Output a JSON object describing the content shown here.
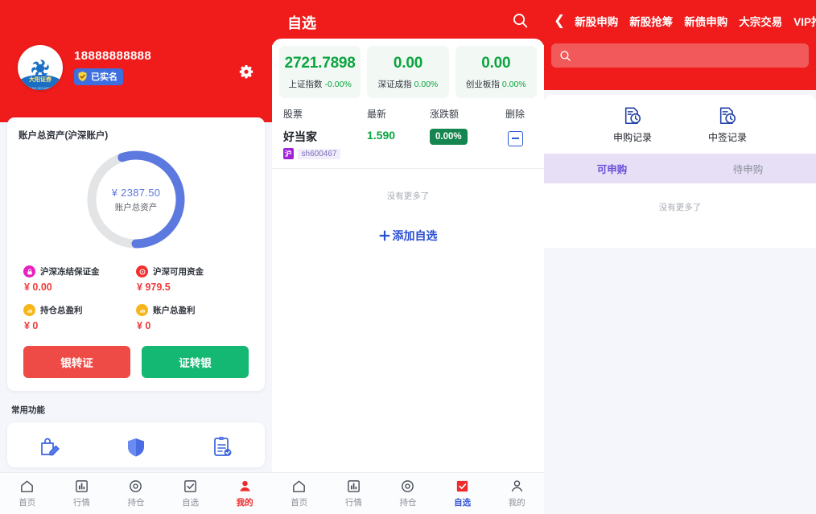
{
  "panel1": {
    "header": {
      "logo_name": "大阳证券",
      "logo_sub": "DAYANG SECURITIES",
      "phone": "18888888888",
      "verified_label": "已实名",
      "gear_icon": "gear-icon"
    },
    "asset_card": {
      "title": "账户总资产(沪深账户)",
      "donut_value": "¥ 2387.50",
      "donut_label": "账户总资产",
      "donut_percent": 55,
      "stats": [
        {
          "label": "沪深冻结保证金",
          "value": "¥ 0.00",
          "icon": "lock-circle-icon",
          "icon_color": "#e91fc0"
        },
        {
          "label": "沪深可用资金",
          "value": "¥ 979.5",
          "icon": "coin-circle-icon",
          "icon_color": "#f0312f"
        },
        {
          "label": "持仓总盈利",
          "value": "¥ 0",
          "icon": "chart-circle-icon",
          "icon_color": "#f7b519"
        },
        {
          "label": "账户总盈利",
          "value": "¥ 0",
          "icon": "chart-circle-icon",
          "icon_color": "#f7b519"
        }
      ],
      "btn_in": "银转证",
      "btn_out": "证转银"
    },
    "functions_title": "常用功能",
    "functions": [
      {
        "name": "edit-bag-icon"
      },
      {
        "name": "shield-icon"
      },
      {
        "name": "clipboard-check-icon"
      }
    ],
    "tabbar": [
      {
        "label": "首页",
        "icon": "home-icon",
        "active": false
      },
      {
        "label": "行情",
        "icon": "chart-bar-icon",
        "active": false
      },
      {
        "label": "持仓",
        "icon": "target-icon",
        "active": false
      },
      {
        "label": "自选",
        "icon": "checkbox-icon",
        "active": false
      },
      {
        "label": "我的",
        "icon": "user-icon",
        "active": true
      }
    ]
  },
  "panel2": {
    "title": "自选",
    "search_icon": "search-icon",
    "indexes": [
      {
        "value": "2721.7898",
        "name": "上证指数",
        "pct": "-0.00%"
      },
      {
        "value": "0.00",
        "name": "深证成指",
        "pct": "0.00%"
      },
      {
        "value": "0.00",
        "name": "创业板指",
        "pct": "0.00%"
      }
    ],
    "columns": [
      "股票",
      "最新",
      "涨跌额",
      "删除"
    ],
    "rows": [
      {
        "name": "好当家",
        "exchange_badge": "沪",
        "code": "sh600467",
        "last": "1.590",
        "change": "0.00%",
        "delete_icon": "minus-box-icon"
      }
    ],
    "no_more": "没有更多了",
    "add_label": "添加自选",
    "tabbar": [
      {
        "label": "首页",
        "icon": "home-icon",
        "active": false
      },
      {
        "label": "行情",
        "icon": "chart-bar-icon",
        "active": false
      },
      {
        "label": "持仓",
        "icon": "target-icon",
        "active": false
      },
      {
        "label": "自选",
        "icon": "checkbox-icon",
        "active": true
      },
      {
        "label": "我的",
        "icon": "user-icon",
        "active": false
      }
    ]
  },
  "panel3": {
    "back_icon": "chevron-left-icon",
    "tabs": [
      {
        "label": "新股申购",
        "active": true
      },
      {
        "label": "新股抢筹",
        "active": false
      },
      {
        "label": "新债申购",
        "active": false
      },
      {
        "label": "大宗交易",
        "active": false
      },
      {
        "label": "VIP抢筹",
        "active": false
      }
    ],
    "search_placeholder": "",
    "search_icon": "search-icon",
    "quick_actions": [
      {
        "label": "申购记录",
        "icon": "doc-clock-icon"
      },
      {
        "label": "中签记录",
        "icon": "doc-clock-icon"
      }
    ],
    "subtabs": [
      {
        "label": "可申购",
        "active": true
      },
      {
        "label": "待申购",
        "active": false
      }
    ],
    "no_more": "没有更多了"
  },
  "colors": {
    "brand_red": "#f01b1b",
    "accent_blue": "#5c79e0",
    "green": "#0aa53f",
    "purple": "#6b4fd8"
  }
}
